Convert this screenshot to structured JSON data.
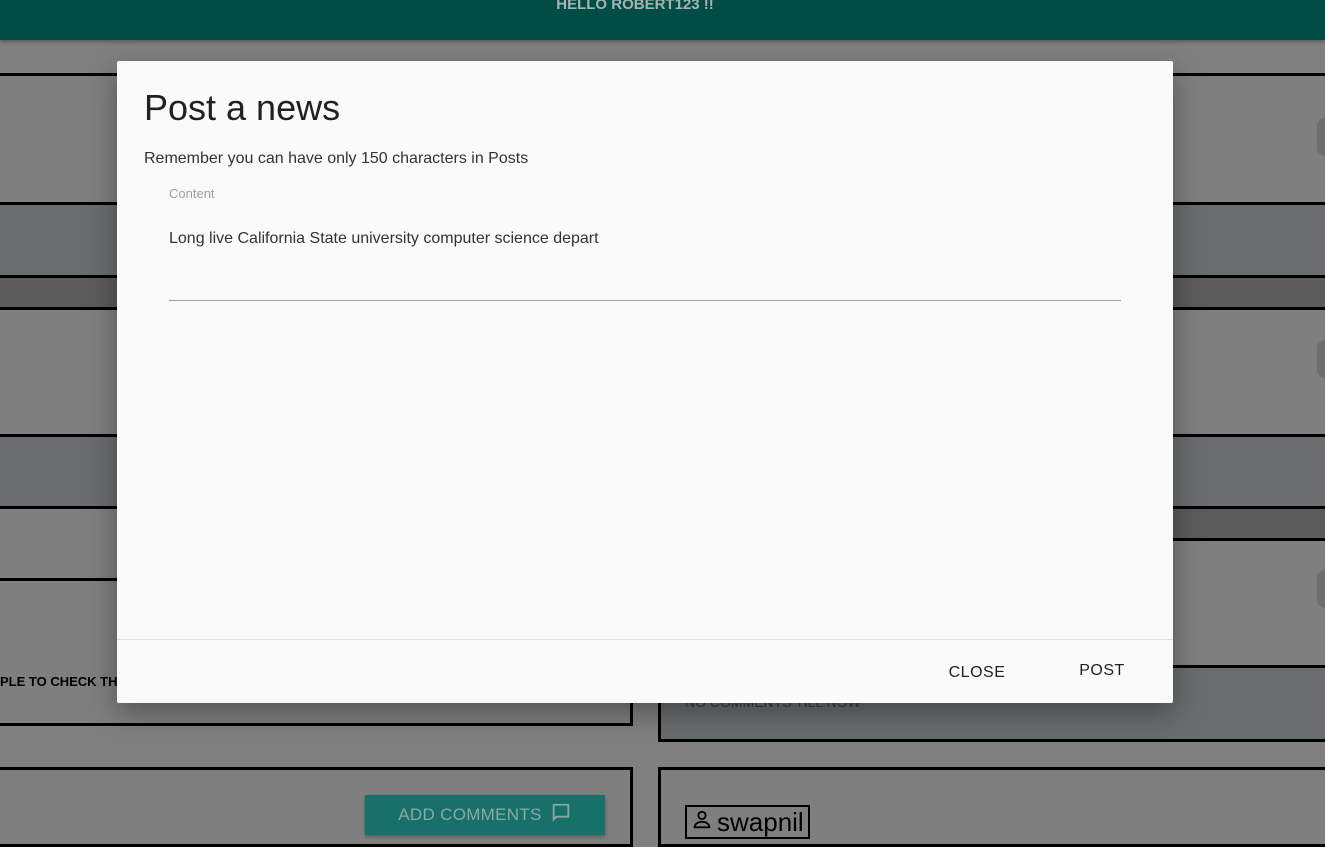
{
  "header": {
    "greeting": "HELLO ROBERT123 !!"
  },
  "background": {
    "left_truncated_text": "PLE TO CHECK TH",
    "comments_status": "NO COMMENTS TILL NOW",
    "add_comments_label": "ADD COMMENTS",
    "username": "swapnil",
    "comment_icon": "comment-icon",
    "user_icon": "person-icon"
  },
  "dialog": {
    "title": "Post a news",
    "description": "Remember you can have only 150 characters in Posts",
    "content_label": "Content",
    "content_value": "Long live California State university computer science depart",
    "close_label": "CLOSE",
    "post_label": "POST"
  },
  "colors": {
    "header": "#004d45",
    "overlay": "#808080",
    "dialog_bg": "#fafafa",
    "accent_button": "#17706a"
  }
}
